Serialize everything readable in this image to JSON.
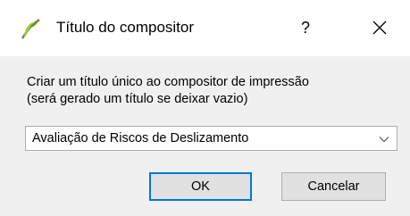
{
  "window": {
    "title": "Título do compositor",
    "help_label": "?",
    "icon": "qgis-logo-icon"
  },
  "dialog": {
    "description_line1": "Criar um título único ao compositor de impressão",
    "description_line2": "(será gerado um título se deixar vazio)",
    "combo_value": "Avaliação de Riscos de Deslizamento",
    "ok_label": "OK",
    "cancel_label": "Cancelar"
  },
  "colors": {
    "accent": "#0078d7",
    "dialog_bg": "#f0f0f0",
    "titlebar_bg": "#ffffff"
  }
}
